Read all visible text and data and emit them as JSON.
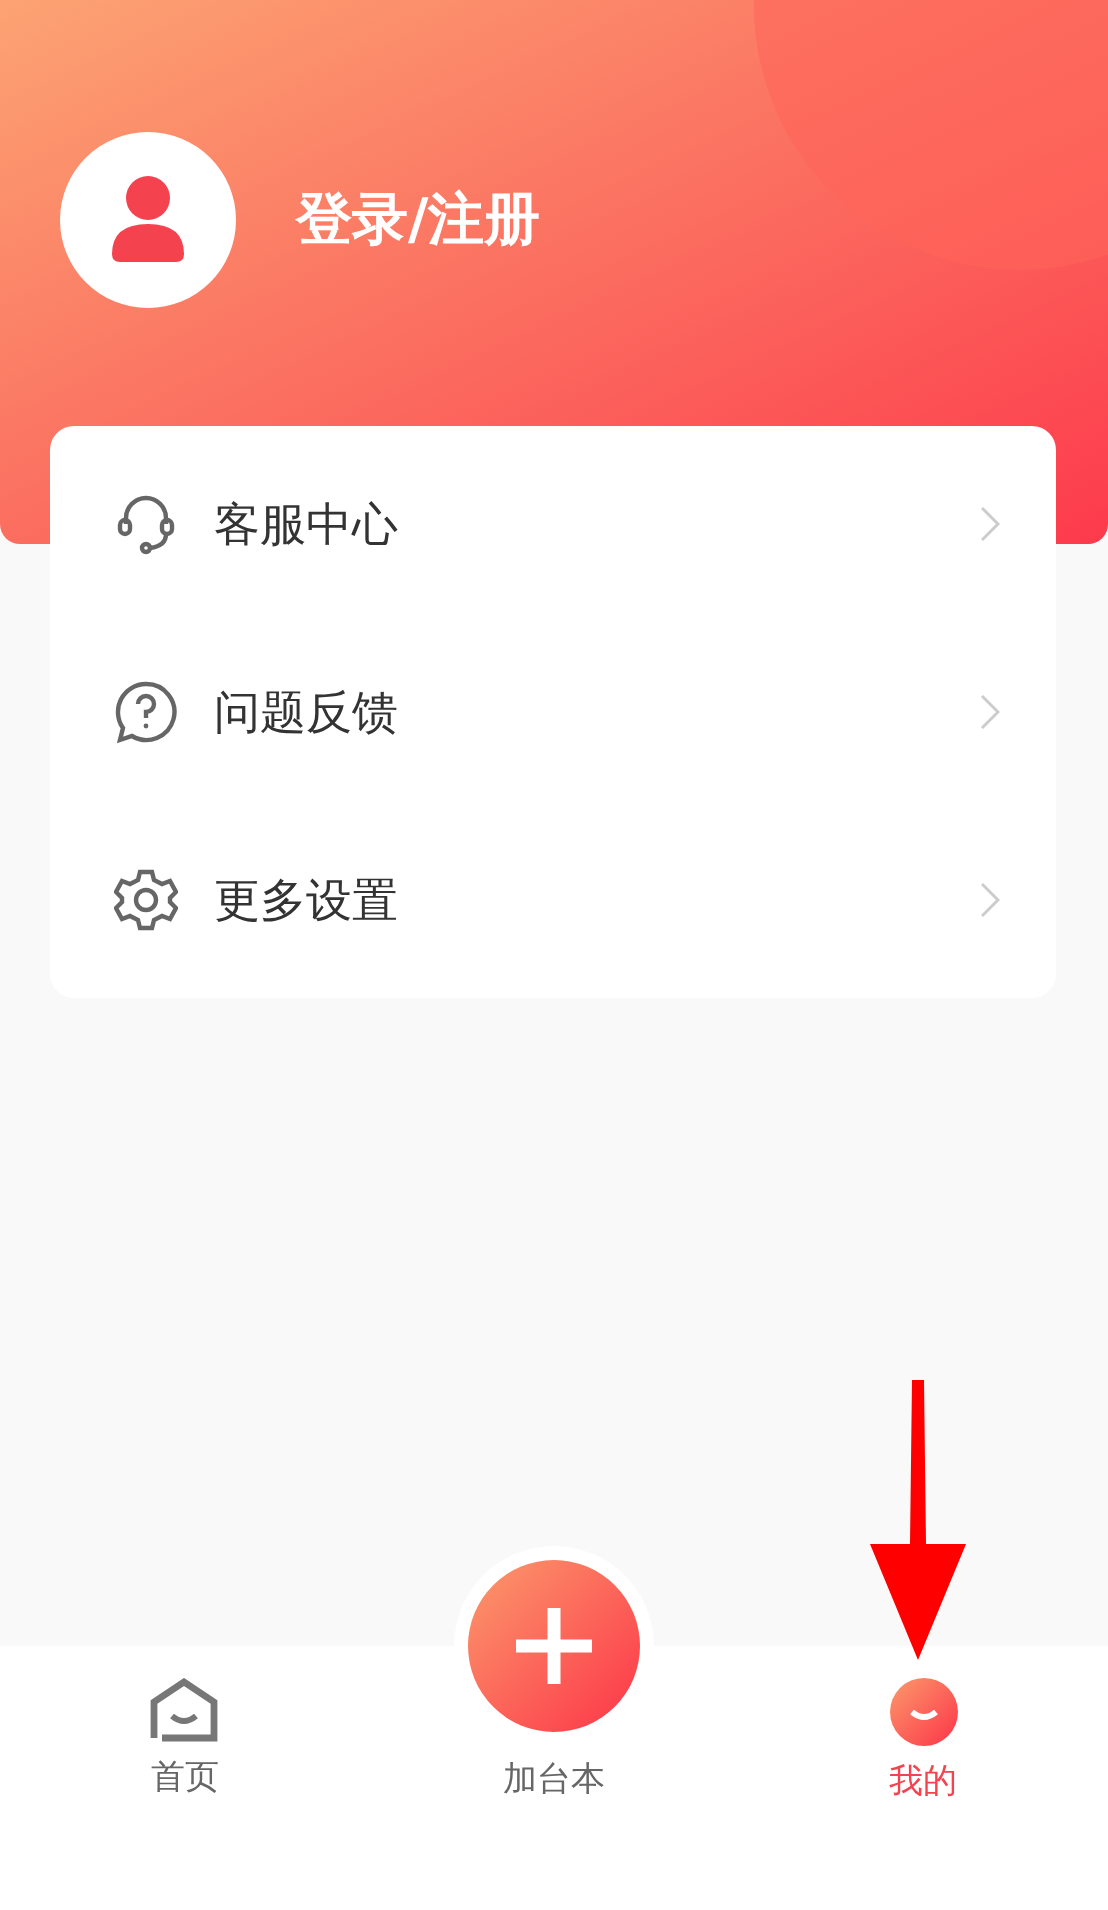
{
  "profile": {
    "login_label": "登录/注册"
  },
  "menu": [
    {
      "label": "客服中心",
      "kind": "support"
    },
    {
      "label": "问题反馈",
      "kind": "feedback"
    },
    {
      "label": "更多设置",
      "kind": "settings"
    }
  ],
  "tab_bar": [
    {
      "label": "首页",
      "kind": "home",
      "selected": false
    },
    {
      "label": "加台本",
      "kind": "add",
      "selected": false
    },
    {
      "label": "我的",
      "kind": "mine",
      "selected": true
    }
  ]
}
